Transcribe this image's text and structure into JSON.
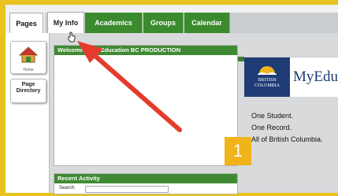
{
  "tabs": {
    "pages": "Pages",
    "my_info": "My Info",
    "academics": "Academics",
    "groups": "Groups",
    "calendar": "Calendar"
  },
  "sidebar": {
    "home_label": "Home",
    "page_directory_label": "Page Directory"
  },
  "welcome_panel": {
    "title": "Welcome to MyEducation BC PRODUCTION"
  },
  "banner": {
    "province_name": "BRITISH COLUMBIA",
    "product_name": "MyEdu",
    "slogan_line1": "One Student.",
    "slogan_line2": "One Record.",
    "slogan_line3": "All of British Columbia."
  },
  "recent_activity": {
    "title": "Recent Activity",
    "search_label": "Search:",
    "search_value": ""
  },
  "step_badge": "1",
  "colors": {
    "frame": "#e8c21e",
    "tab_green": "#3b8a2d",
    "panel_green": "#3f8a33",
    "bc_blue": "#1f3c77",
    "badge_gold": "#f0b41a",
    "arrow_red": "#e53b2c"
  }
}
